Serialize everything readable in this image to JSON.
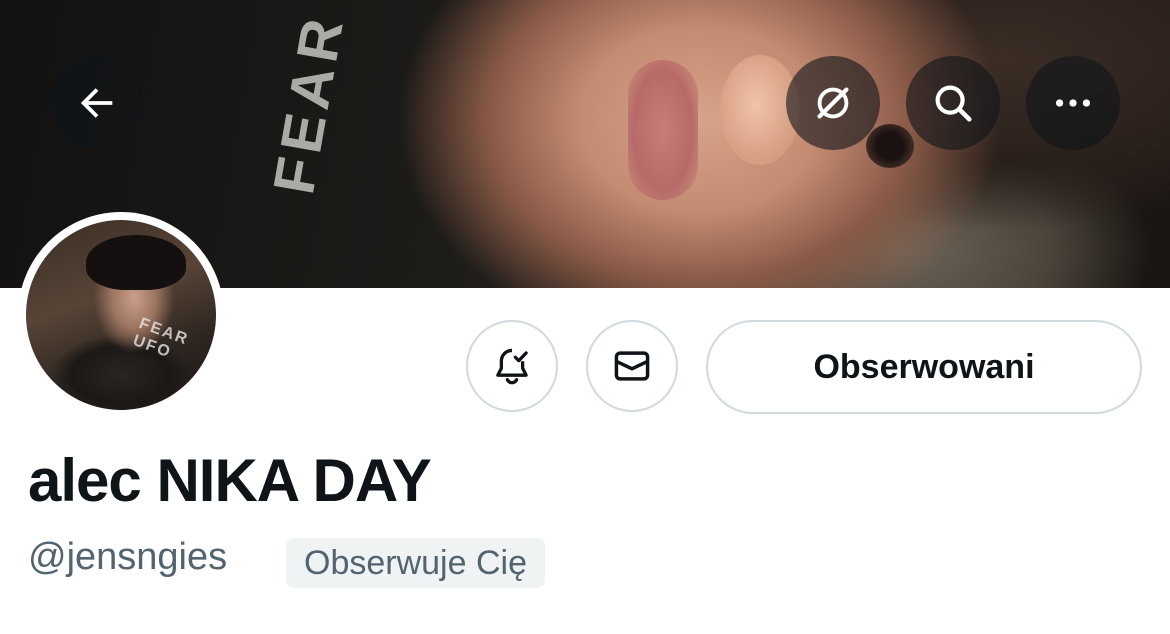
{
  "profile": {
    "display_name": "alec NIKA DAY",
    "handle": "@jensngies",
    "follows_you_badge": "Obserwuje Cię"
  },
  "actions": {
    "follow_label": "Obserwowani"
  },
  "icons": {
    "back": "arrow-left-icon",
    "grok": "grok-slash-icon",
    "search": "search-icon",
    "more": "more-horizontal-icon",
    "notifications": "bell-check-icon",
    "message": "envelope-icon"
  },
  "colors": {
    "text_primary": "#0f1419",
    "text_secondary": "#536471",
    "border": "#cfd9de",
    "badge_bg": "#eff3f4"
  }
}
